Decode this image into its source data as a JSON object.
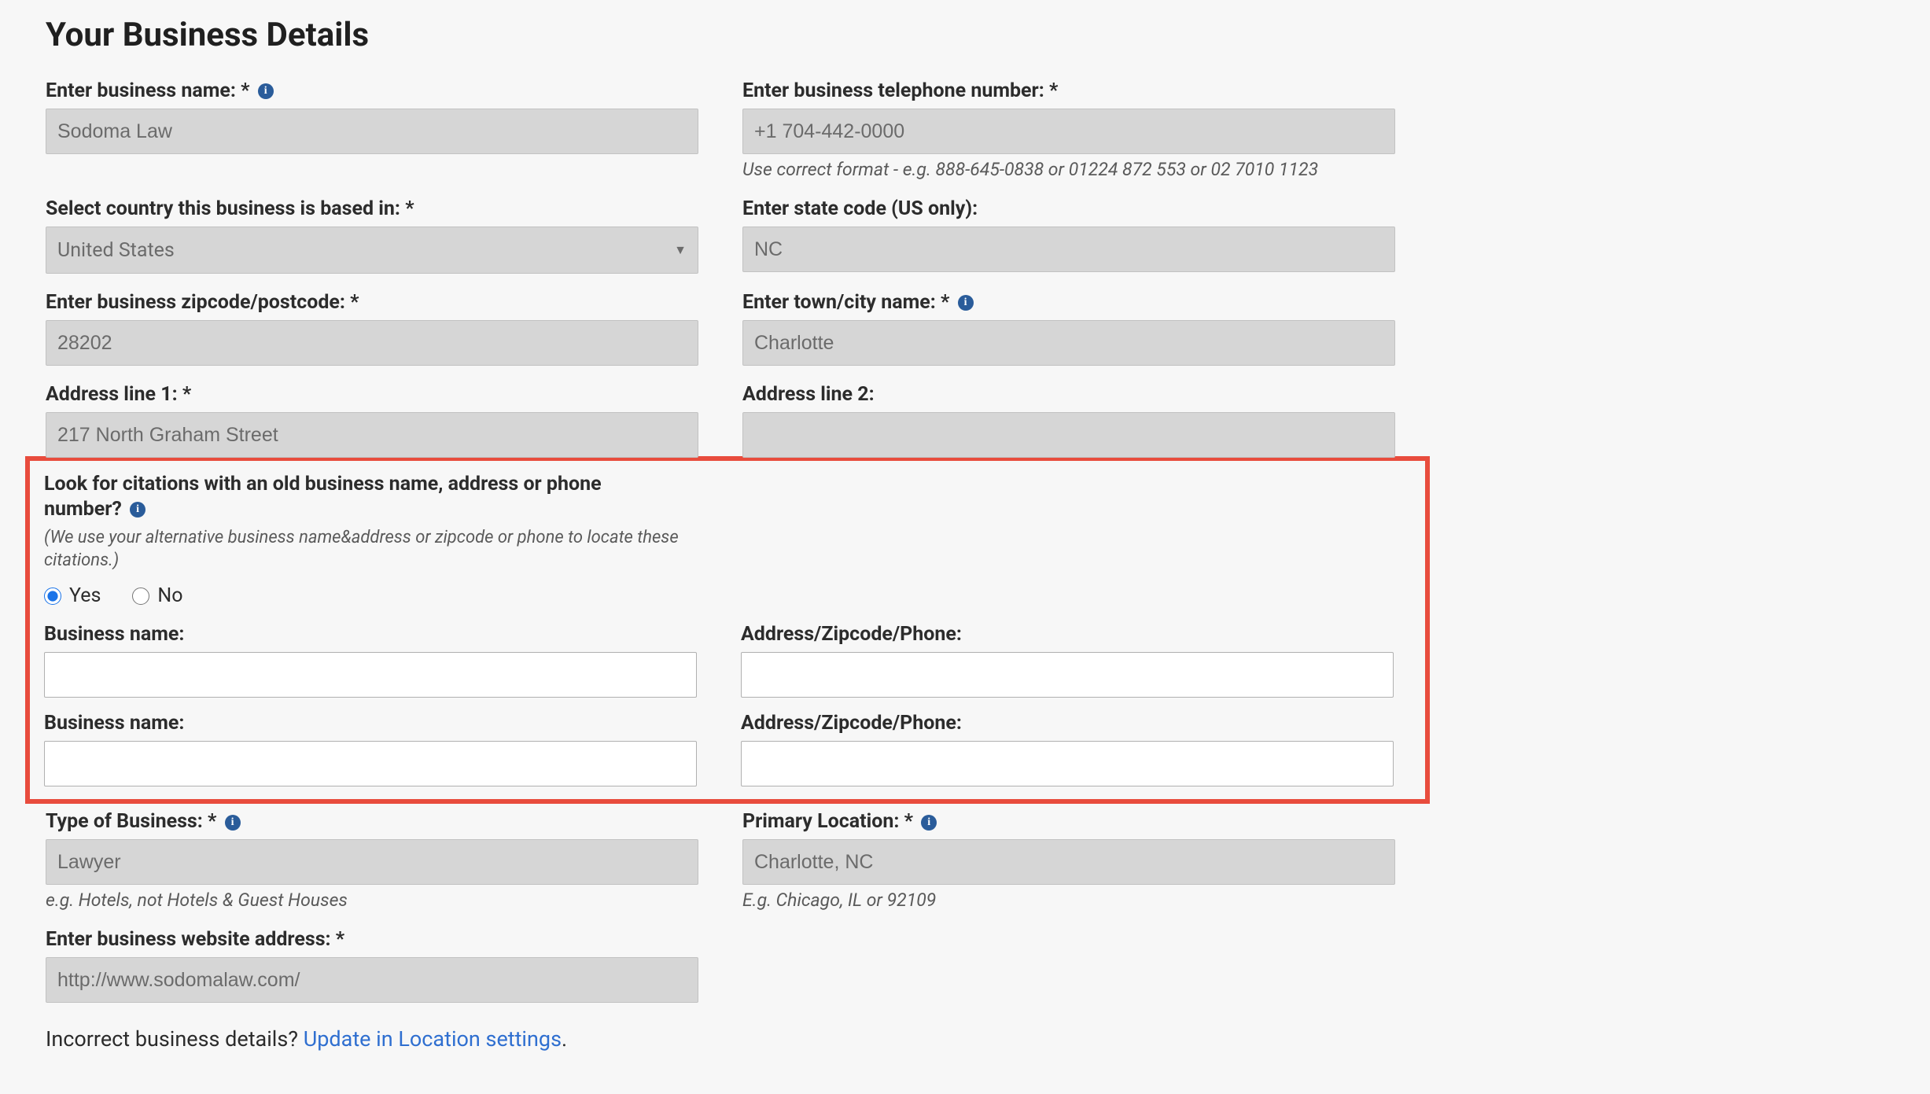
{
  "title": "Your Business Details",
  "fields": {
    "businessName": {
      "label": "Enter business name: *",
      "value": "Sodoma Law"
    },
    "telephone": {
      "label": "Enter business telephone number: *",
      "value": "+1 704-442-0000",
      "helper": "Use correct format - e.g. 888-645-0838 or 01224 872 553 or 02 7010 1123"
    },
    "country": {
      "label": "Select country this business is based in: *",
      "value": "United States"
    },
    "stateCode": {
      "label": "Enter state code (US only):",
      "value": "NC"
    },
    "zipcode": {
      "label": "Enter business zipcode/postcode: *",
      "value": "28202"
    },
    "townCity": {
      "label": "Enter town/city name: *",
      "value": "Charlotte"
    },
    "address1": {
      "label": "Address line 1: *",
      "value": "217 North Graham Street"
    },
    "address2": {
      "label": "Address line 2:",
      "value": ""
    },
    "citations": {
      "label": "Look for citations with an old business name, address or phone number?",
      "helper": "(We use your alternative business name&address or zipcode or phone to locate these citations.)",
      "yes": "Yes",
      "no": "No",
      "altBusinessName1Label": "Business name:",
      "altAddress1Label": "Address/Zipcode/Phone:",
      "altBusinessName2Label": "Business name:",
      "altAddress2Label": "Address/Zipcode/Phone:"
    },
    "businessType": {
      "label": "Type of Business: *",
      "value": "Lawyer",
      "helper": "e.g. Hotels, not Hotels & Guest Houses"
    },
    "primaryLocation": {
      "label": "Primary Location: *",
      "value": "Charlotte, NC",
      "helper": "E.g. Chicago, IL or 92109"
    },
    "website": {
      "label": "Enter business website address: *",
      "value": "http://www.sodomalaw.com/"
    }
  },
  "footer": {
    "prefix": "Incorrect business details? ",
    "link": "Update in Location settings",
    "suffix": "."
  }
}
